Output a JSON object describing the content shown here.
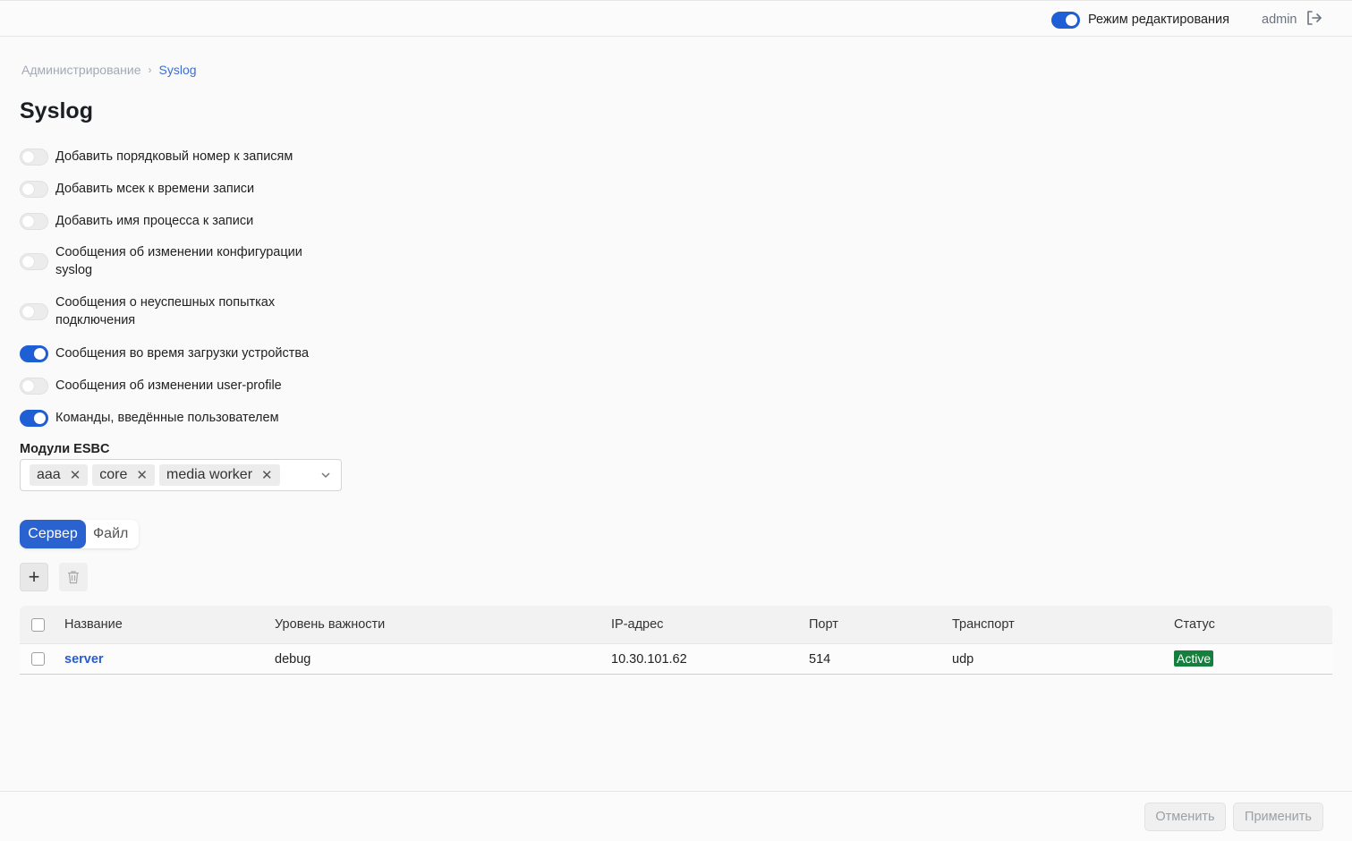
{
  "header": {
    "edit_mode_label": "Режим редактирования",
    "edit_mode_on": true,
    "username": "admin"
  },
  "breadcrumb": {
    "root": "Администрирование",
    "current": "Syslog"
  },
  "page": {
    "title": "Syslog"
  },
  "options": [
    {
      "label": "Добавить порядковый номер к записям",
      "on": false
    },
    {
      "label": "Добавить мсек к времени записи",
      "on": false
    },
    {
      "label": "Добавить имя процесса к записи",
      "on": false
    },
    {
      "label": "Сообщения об изменении конфигурации syslog",
      "on": false
    },
    {
      "label": "Сообщения о неуспешных попытках подключения",
      "on": false
    },
    {
      "label": "Сообщения во время загрузки устройства",
      "on": true
    },
    {
      "label": "Сообщения об изменении user-profile",
      "on": false
    },
    {
      "label": "Команды, введённые пользователем",
      "on": true
    }
  ],
  "modules": {
    "label": "Модули ESBC",
    "selected": [
      "aaa",
      "core",
      "media worker"
    ]
  },
  "tabs": [
    {
      "label": "Сервер",
      "active": true
    },
    {
      "label": "Файл",
      "active": false
    }
  ],
  "table": {
    "columns": [
      "Название",
      "Уровень важности",
      "IP-адрес",
      "Порт",
      "Транспорт",
      "Статус"
    ],
    "rows": [
      {
        "name": "server",
        "severity": "debug",
        "ip": "10.30.101.62",
        "port": "514",
        "transport": "udp",
        "status": "Active"
      }
    ]
  },
  "footer": {
    "cancel_label": "Отменить",
    "apply_label": "Применить"
  },
  "colors": {
    "accent": "#2a62cf",
    "status_active": "#15803d"
  }
}
